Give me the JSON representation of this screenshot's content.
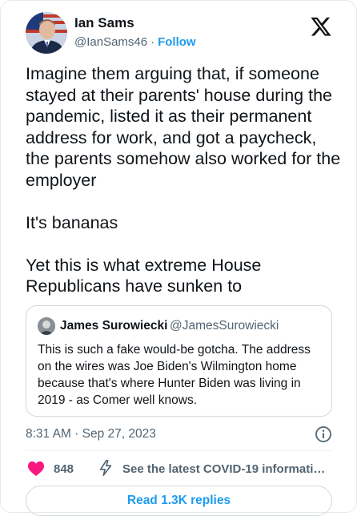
{
  "author": {
    "name": "Ian Sams",
    "handle": "@IanSams46",
    "separator": "·",
    "follow_label": "Follow"
  },
  "tweet": {
    "paragraphs": [
      "Imagine them arguing that, if someone stayed at their parents' house during the pandemic, listed it as their permanent address for work, and got a paycheck, the parents somehow also worked for the employer",
      "It's bananas",
      "Yet this is what extreme House Republicans have sunken to"
    ]
  },
  "quoted": {
    "name": "James Surowiecki",
    "handle": "@JamesSurowiecki",
    "text": "This is such a fake would-be gotcha. The address on the wires was Joe Biden's Wilmington home because that's where Hunter Biden was living in 2019 - as Comer well knows."
  },
  "meta": {
    "timestamp": "8:31 AM · Sep 27, 2023"
  },
  "engagement": {
    "likes": "848",
    "notice": "See the latest COVID-19 information..."
  },
  "replies_button": "Read 1.3K replies",
  "icons": {
    "brand": "x-logo-icon",
    "info": "info-icon",
    "like": "heart-icon",
    "notice": "bolt-icon"
  },
  "colors": {
    "accent": "#1d9bf0",
    "like": "#f91880",
    "text": "#0f1419",
    "secondary": "#536471"
  }
}
